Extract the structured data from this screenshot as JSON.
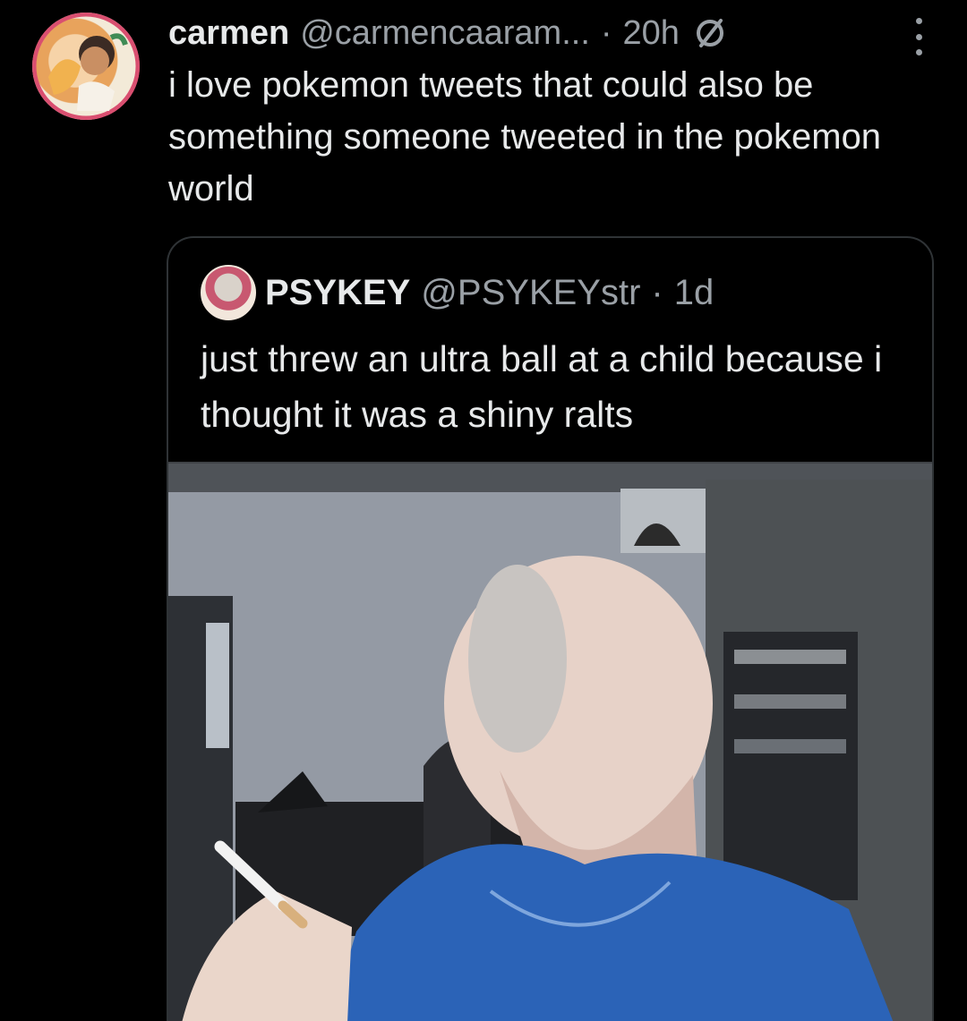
{
  "tweet": {
    "author_name": "carmen",
    "author_handle": "@carmencaaram...",
    "separator": "·",
    "time": "20h",
    "text": "i love pokemon tweets that could also be something someone tweeted in the pokemon world"
  },
  "quoted_tweet": {
    "author_name": "PSYKEY",
    "author_handle": "@PSYKEYstr",
    "separator": "·",
    "time": "1d",
    "text": "just threw an ultra ball at a child because i thought it was a shiny ralts"
  },
  "icons": {
    "status": "ghost-slash-icon",
    "more": "more-options-icon"
  },
  "colors": {
    "background": "#000000",
    "primary_text": "#e7e9ea",
    "secondary_text": "#9aa0a6",
    "border": "#2f3336"
  }
}
